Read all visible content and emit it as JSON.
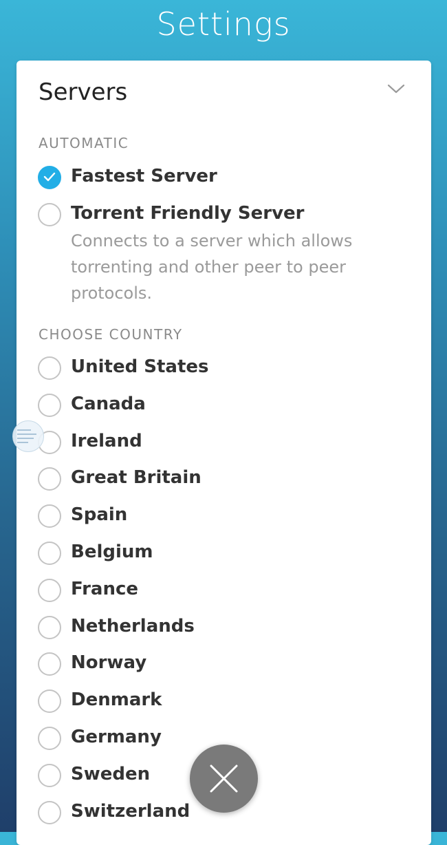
{
  "header": {
    "title": "Settings"
  },
  "servers_card": {
    "title": "Servers",
    "automatic_section": {
      "label": "AUTOMATIC",
      "options": [
        {
          "label": "Fastest Server",
          "selected": true
        },
        {
          "label": "Torrent Friendly Server",
          "selected": false,
          "description": "Connects to a server which allows torrenting and other peer to peer protocols."
        }
      ]
    },
    "country_section": {
      "label": "CHOOSE COUNTRY",
      "countries": [
        "United States",
        "Canada",
        "Ireland",
        "Great Britain",
        "Spain",
        "Belgium",
        "France",
        "Netherlands",
        "Norway",
        "Denmark",
        "Germany",
        "Sweden",
        "Switzerland"
      ]
    }
  },
  "icons": {
    "expand": "chevron-down-icon",
    "selected": "checkmark-icon",
    "close": "close-icon"
  },
  "colors": {
    "accent": "#22aee6",
    "radio_border": "#c4c4c4",
    "close_button": "#7a7a7a"
  }
}
